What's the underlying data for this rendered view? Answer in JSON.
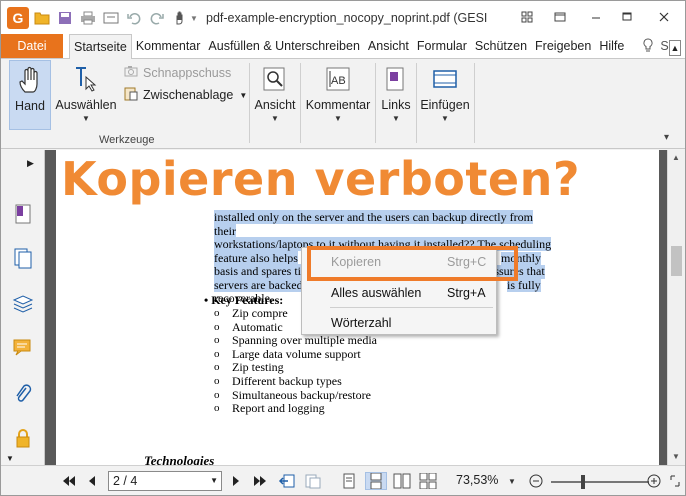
{
  "app": {
    "logo_letter": "G",
    "title": "pdf-example-encryption_nocopy_noprint.pdf (GESICH..."
  },
  "menu": {
    "file": "Datei",
    "tabs": [
      "Startseite",
      "Kommentar",
      "Ausfüllen & Unterschreiben",
      "Ansicht",
      "Formular",
      "Schützen",
      "Freigeben",
      "Hilfe"
    ],
    "help_search_partial": "Si"
  },
  "ribbon": {
    "hand": "Hand",
    "select": "Auswählen",
    "snapshot": "Schnappschuss",
    "clipboard": "Zwischenablage",
    "view": "Ansicht",
    "comment": "Kommentar",
    "links": "Links",
    "insert": "Einfügen",
    "group_tools": "Werkzeuge"
  },
  "document": {
    "headline": "Kopieren verboten?",
    "para_lines": [
      "installed only on the server and the users can backup directly from their",
      "workstations/laptops to it without having it installed?? The scheduling",
      "feature also helps",
      "basis and spares ti",
      "servers are backed",
      "recoverable."
    ],
    "para_line3_tail": "monthly",
    "para_line4_tail": "assures that",
    "para_line5_tail": "is fully",
    "key_features_label": "Key Features:",
    "features": [
      "Zip compre",
      "Automatic",
      "Spanning over multiple media",
      "Large data volume support",
      "Zip testing",
      "Different backup types",
      "Simultaneous backup/restore",
      "Report and logging"
    ],
    "technologies_label": "Technologies"
  },
  "context_menu": {
    "copy": "Kopieren",
    "copy_shortcut": "Strg+C",
    "select_all": "Alles auswählen",
    "select_all_shortcut": "Strg+A",
    "word_count": "Wörterzahl"
  },
  "status": {
    "page": "2 / 4",
    "zoom": "73,53%"
  },
  "colors": {
    "accent": "#e8731c",
    "headline": "#f08a34",
    "selection": "#b7cfee",
    "highlight_box": "#ef7b2a"
  }
}
